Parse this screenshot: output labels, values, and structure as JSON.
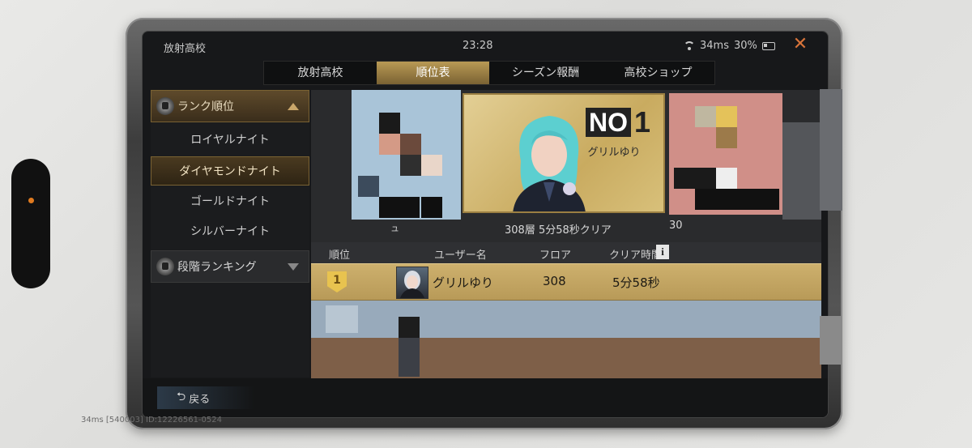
{
  "status": {
    "school_label": "放射高校",
    "time": "23:28",
    "latency": "34ms",
    "battery": "30%"
  },
  "tabs": [
    {
      "label": "放射高校"
    },
    {
      "label": "順位表"
    },
    {
      "label": "シーズン報酬"
    },
    {
      "label": "高校ショップ"
    }
  ],
  "sidebar": {
    "rank_header": "ランク順位",
    "items": [
      {
        "label": "ロイヤルナイト"
      },
      {
        "label": "ダイヤモンドナイト"
      },
      {
        "label": "ゴールドナイト"
      },
      {
        "label": "シルバーナイト"
      }
    ],
    "stage_header": "段階ランキング"
  },
  "banner": {
    "no_label": "NO",
    "no_number": "1",
    "first_name": "グリルゆり",
    "clear_text": "308層 5分58秒クリア",
    "second_prefix": "ュ",
    "third_prefix": "30"
  },
  "table": {
    "headers": {
      "rank": "順位",
      "user": "ユーザー名",
      "floor": "フロア",
      "time": "クリア時間"
    },
    "rows": [
      {
        "rank": "1",
        "user": "グリルゆり",
        "floor": "308",
        "time": "5分58秒"
      }
    ]
  },
  "footer": {
    "back_label": "戻る",
    "debug": "34ms [540003] ID:12226561-0524"
  },
  "colors": {
    "accent_gold": "#c9a66a",
    "close_orange": "#d8743a"
  }
}
